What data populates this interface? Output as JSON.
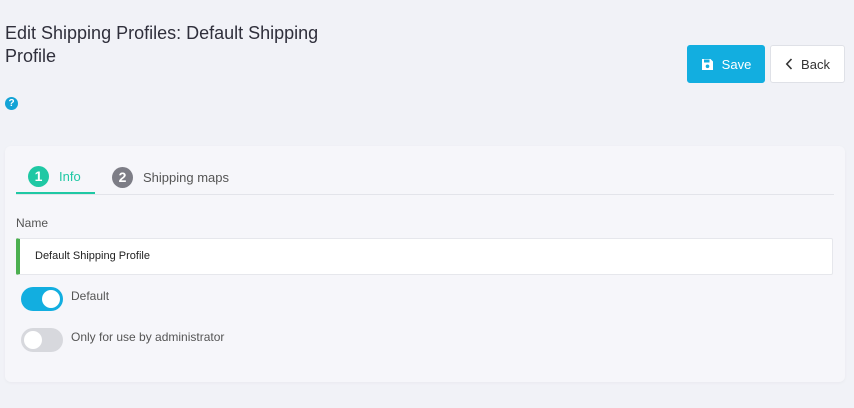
{
  "header": {
    "title": "Edit Shipping Profiles: Default Shipping Profile",
    "help_icon": "question-circle-icon"
  },
  "toolbar": {
    "save_label": "Save",
    "back_label": "Back",
    "save_icon": "floppy-disk-icon",
    "back_icon": "chevron-left-icon"
  },
  "tabs": [
    {
      "number": "1",
      "label": "Info",
      "active": true
    },
    {
      "number": "2",
      "label": "Shipping maps",
      "active": false
    }
  ],
  "form": {
    "name_label": "Name",
    "name_value": "Default Shipping Profile",
    "toggles": [
      {
        "label": "Default",
        "on": true
      },
      {
        "label": "Only for use by administrator",
        "on": false
      }
    ]
  },
  "colors": {
    "accent_blue": "#12aee0",
    "active_tab_green": "#1fc8a4",
    "input_valid_green": "#4caf50",
    "background": "#f1f2f7"
  }
}
